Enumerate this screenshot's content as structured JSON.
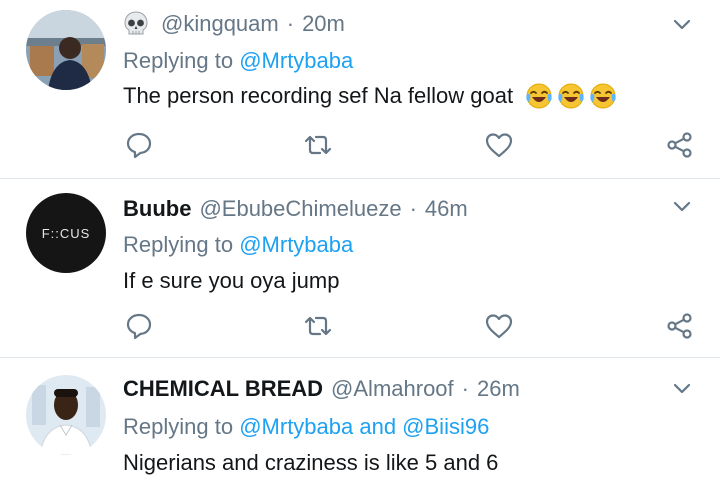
{
  "tweets": [
    {
      "handle": "@kingquam",
      "time": "20m",
      "reply_prefix": "Replying to",
      "mentions": "@Mrtybaba",
      "text": "The person recording sef Na fellow goat",
      "name_icon": "skull-emoji-icon",
      "text_emoji": [
        "face-with-tears-of-joy-icon",
        "face-with-tears-of-joy-icon",
        "face-with-tears-of-joy-icon"
      ]
    },
    {
      "name": "Buube",
      "handle": "@EbubeChimelueze",
      "time": "46m",
      "reply_prefix": "Replying to",
      "mentions": "@Mrtybaba",
      "text": "If e sure you oya jump",
      "avatar_text": "F::CUS"
    },
    {
      "name": "CHEMICAL BREAD",
      "handle": "@Almahroof",
      "time": "26m",
      "reply_prefix": "Replying to",
      "mentions": "@Mrtybaba and @Biisi96",
      "text": "Nigerians and craziness is like 5 and 6"
    }
  ],
  "icons": {
    "reply": "reply-icon",
    "retweet": "retweet-icon",
    "like": "like-icon",
    "share": "share-icon",
    "more": "chevron-down-icon"
  },
  "colors": {
    "link": "#1da1f2",
    "secondary_text": "#657786",
    "icon": "#657786",
    "divider": "#e1e8ed",
    "text": "#14171a"
  }
}
